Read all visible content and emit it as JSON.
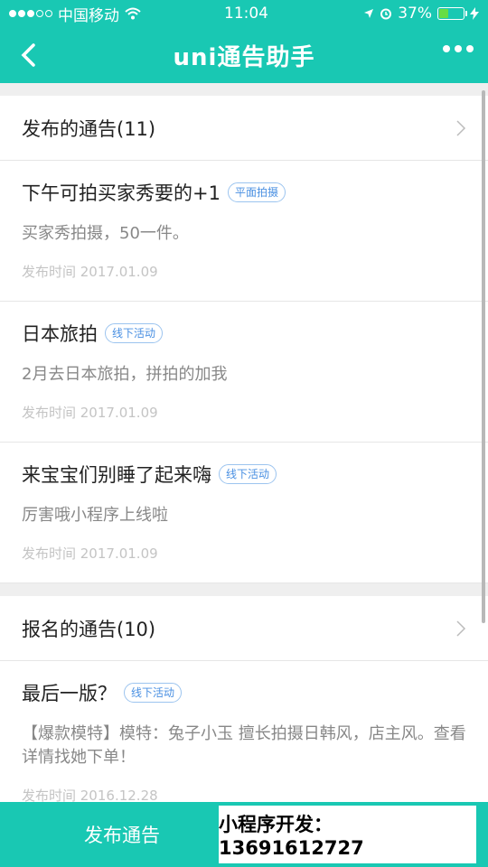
{
  "status_bar": {
    "carrier": "中国移动",
    "time": "11:04",
    "battery_percent": "37%",
    "battery_level": 0.37
  },
  "nav": {
    "title": "uni通告助手"
  },
  "published_section": {
    "title": "发布的通告(11)",
    "items": [
      {
        "title": "下午可拍买家秀要的+1",
        "tag": "平面拍摄",
        "desc": "买家秀拍摄，50一件。",
        "time": "发布时间 2017.01.09"
      },
      {
        "title": "日本旅拍",
        "tag": "线下活动",
        "desc": "2月去日本旅拍，拼拍的加我",
        "time": "发布时间 2017.01.09"
      },
      {
        "title": "来宝宝们别睡了起来嗨",
        "tag": "线下活动",
        "desc": "厉害哦小程序上线啦",
        "time": "发布时间 2017.01.09"
      }
    ]
  },
  "signup_section": {
    "title": "报名的通告(10)",
    "items": [
      {
        "title": "最后一版？",
        "tag": "线下活动",
        "desc": "【爆款模特】模特：兔子小玉 擅长拍摄日韩风，店主风。查看详情找她下单！",
        "time": "发布时间 2016.12.28"
      }
    ]
  },
  "bottom_bar": {
    "publish_label": "发布通告",
    "promo_text": "小程序开发：13691612727"
  },
  "colors": {
    "accent": "#19c8b3",
    "tag_blue": "#4a90e2"
  }
}
